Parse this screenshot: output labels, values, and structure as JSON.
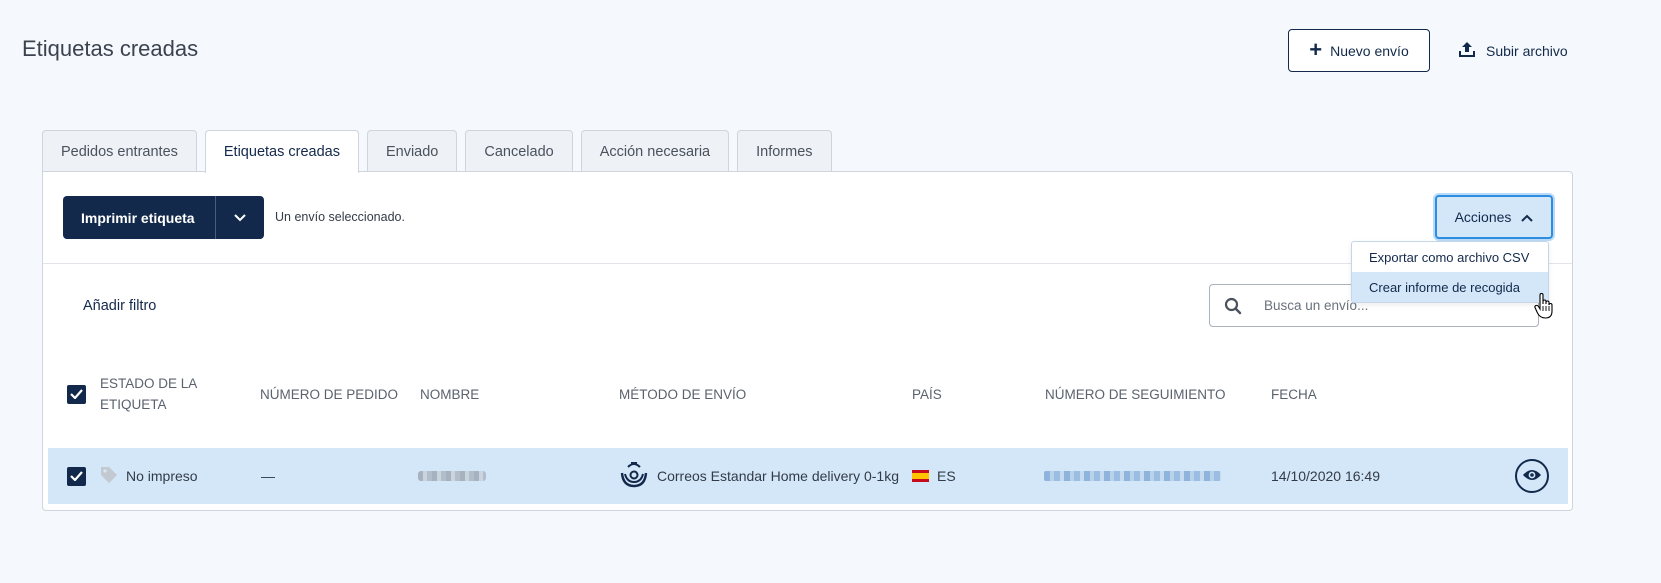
{
  "header": {
    "title": "Etiquetas creadas",
    "new_shipment_label": "Nuevo envío",
    "upload_label": "Subir archivo"
  },
  "tabs": [
    {
      "label": "Pedidos entrantes",
      "active": false
    },
    {
      "label": "Etiquetas creadas",
      "active": true
    },
    {
      "label": "Enviado",
      "active": false
    },
    {
      "label": "Cancelado",
      "active": false
    },
    {
      "label": "Acción necesaria",
      "active": false
    },
    {
      "label": "Informes",
      "active": false
    }
  ],
  "toolbar": {
    "print_label": "Imprimir etiqueta",
    "selected_note": "Un envío seleccionado.",
    "actions_label": "Acciones"
  },
  "actions_menu": {
    "items": [
      {
        "label": "Exportar como archivo CSV",
        "hovered": false
      },
      {
        "label": "Crear informe de recogida",
        "hovered": true
      }
    ]
  },
  "filter": {
    "add_filter_label": "Añadir filtro",
    "search_placeholder": "Busca un envío..."
  },
  "table": {
    "headers": {
      "status": "ESTADO DE LA ETIQUETA",
      "order_number": "NÚMERO DE PEDIDO",
      "name": "NOMBRE",
      "shipping_method": "MÉTODO DE ENVÍO",
      "country": "PAÍS",
      "tracking_number": "NÚMERO DE SEGUIMIENTO",
      "date": "FECHA"
    },
    "rows": [
      {
        "checked": true,
        "status": "No impreso",
        "order_number": "—",
        "shipping_method": "Correos Estandar Home delivery 0-1kg",
        "country": "ES",
        "date": "14/10/2020 16:49"
      }
    ]
  },
  "colors": {
    "primary": "#13294b",
    "selected_row": "#d3e7f9",
    "accent_border": "#2d8de0",
    "background": "#f5f8fc"
  }
}
